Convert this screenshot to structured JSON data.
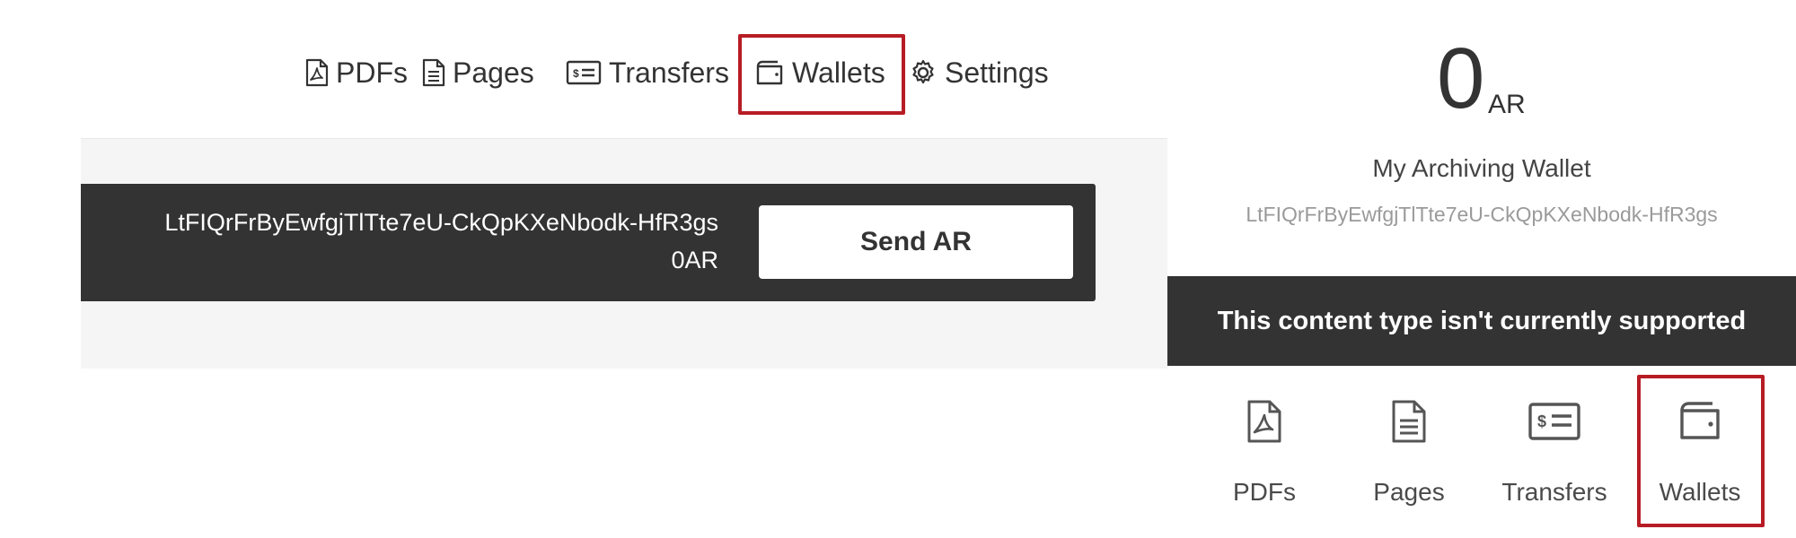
{
  "top_nav": {
    "items": [
      {
        "label": "PDFs",
        "icon": "pdf-icon"
      },
      {
        "label": "Pages",
        "icon": "page-icon"
      },
      {
        "label": "Transfers",
        "icon": "transfer-icon"
      },
      {
        "label": "Wallets",
        "icon": "wallet-icon"
      },
      {
        "label": "Settings",
        "icon": "gear-icon"
      }
    ]
  },
  "wallet_card": {
    "address": "LtFIQrFrByEwfgjTlTte7eU-CkQpKXeNbodk-HfR3gs",
    "balance": "0AR",
    "send_label": "Send AR"
  },
  "summary": {
    "balance_value": "0",
    "balance_unit": "AR",
    "wallet_name": "My Archiving Wallet",
    "wallet_address": "LtFIQrFrByEwfgjTlTte7eU-CkQpKXeNbodk-HfR3gs",
    "unsupported_message": "This content type isn't currently supported"
  },
  "bottom_tabs": {
    "items": [
      {
        "label": "PDFs",
        "icon": "pdf-icon"
      },
      {
        "label": "Pages",
        "icon": "page-icon"
      },
      {
        "label": "Transfers",
        "icon": "transfer-icon"
      },
      {
        "label": "Wallets",
        "icon": "wallet-icon"
      }
    ]
  },
  "colors": {
    "highlight": "#b71c24",
    "dark_bar": "#333333",
    "panel_bg": "#f5f5f5"
  }
}
